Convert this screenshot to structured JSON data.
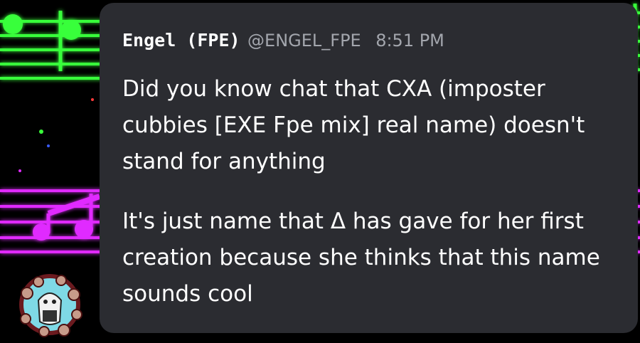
{
  "message": {
    "author_name": "Engel (FPE)",
    "author_handle": "@ENGEL_FPE",
    "timestamp": "8:51 PM",
    "paragraphs": [
      "Did you know chat that CXA (imposter cubbies [EXE Fpe mix] real name) doesn't stand for anything",
      "It's just name that Δ has gave for her first creation because she thinks that this name sounds cool"
    ]
  },
  "colors": {
    "background": "#000000",
    "card": "#2b2c31",
    "text": "#ffffff",
    "muted": "#a3a6ad",
    "green_glow": "#39ff3a",
    "magenta_glow": "#e02bff"
  },
  "icons": {
    "avatar": "avatar-image",
    "background": "music-notes-background"
  }
}
